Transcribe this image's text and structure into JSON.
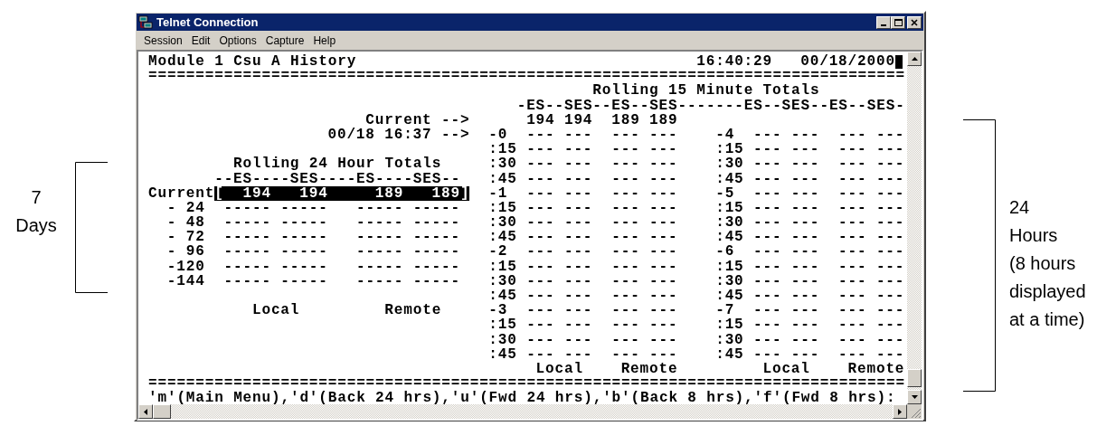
{
  "window": {
    "title": "Telnet Connection"
  },
  "menu": [
    "Session",
    "Edit",
    "Options",
    "Capture",
    "Help"
  ],
  "terminal": {
    "title": "Module 1 Csu A History",
    "time": "16:40:29",
    "date": "00/18/2000",
    "rules": [
      "================================================================================",
      "================================================================================"
    ],
    "pointers": [
      "Current -->",
      "00/18 16:37 -->"
    ],
    "minute_totals": {
      "title": "Rolling 15 Minute Totals",
      "header": "-ES--SES--ES--SES-------ES--SES--ES--SES-",
      "current_values": [
        "194",
        "194",
        "189",
        "189"
      ],
      "blocks": [
        {
          "rows": [
            {
              "label": "-0",
              "values": [
                "---",
                "---",
                "---",
                "---"
              ]
            },
            {
              "label": ":15",
              "values": [
                "---",
                "---",
                "---",
                "---"
              ]
            },
            {
              "label": ":30",
              "values": [
                "---",
                "---",
                "---",
                "---"
              ]
            },
            {
              "label": ":45",
              "values": [
                "---",
                "---",
                "---",
                "---"
              ]
            },
            {
              "label": "-1",
              "values": [
                "---",
                "---",
                "---",
                "---"
              ]
            },
            {
              "label": ":15",
              "values": [
                "---",
                "---",
                "---",
                "---"
              ]
            },
            {
              "label": ":30",
              "values": [
                "---",
                "---",
                "---",
                "---"
              ]
            },
            {
              "label": ":45",
              "values": [
                "---",
                "---",
                "---",
                "---"
              ]
            },
            {
              "label": "-2",
              "values": [
                "---",
                "---",
                "---",
                "---"
              ]
            },
            {
              "label": ":15",
              "values": [
                "---",
                "---",
                "---",
                "---"
              ]
            },
            {
              "label": ":30",
              "values": [
                "---",
                "---",
                "---",
                "---"
              ]
            },
            {
              "label": ":45",
              "values": [
                "---",
                "---",
                "---",
                "---"
              ]
            },
            {
              "label": "-3",
              "values": [
                "---",
                "---",
                "---",
                "---"
              ]
            },
            {
              "label": ":15",
              "values": [
                "---",
                "---",
                "---",
                "---"
              ]
            },
            {
              "label": ":30",
              "values": [
                "---",
                "---",
                "---",
                "---"
              ]
            },
            {
              "label": ":45",
              "values": [
                "---",
                "---",
                "---",
                "---"
              ]
            }
          ]
        },
        {
          "rows": [
            {
              "label": "-4",
              "values": [
                "---",
                "---",
                "---",
                "---"
              ]
            },
            {
              "label": ":15",
              "values": [
                "---",
                "---",
                "---",
                "---"
              ]
            },
            {
              "label": ":30",
              "values": [
                "---",
                "---",
                "---",
                "---"
              ]
            },
            {
              "label": ":45",
              "values": [
                "---",
                "---",
                "---",
                "---"
              ]
            },
            {
              "label": "-5",
              "values": [
                "---",
                "---",
                "---",
                "---"
              ]
            },
            {
              "label": ":15",
              "values": [
                "---",
                "---",
                "---",
                "---"
              ]
            },
            {
              "label": ":30",
              "values": [
                "---",
                "---",
                "---",
                "---"
              ]
            },
            {
              "label": ":45",
              "values": [
                "---",
                "---",
                "---",
                "---"
              ]
            },
            {
              "label": "-6",
              "values": [
                "---",
                "---",
                "---",
                "---"
              ]
            },
            {
              "label": ":15",
              "values": [
                "---",
                "---",
                "---",
                "---"
              ]
            },
            {
              "label": ":30",
              "values": [
                "---",
                "---",
                "---",
                "---"
              ]
            },
            {
              "label": ":45",
              "values": [
                "---",
                "---",
                "---",
                "---"
              ]
            },
            {
              "label": "-7",
              "values": [
                "---",
                "---",
                "---",
                "---"
              ]
            },
            {
              "label": ":15",
              "values": [
                "---",
                "---",
                "---",
                "---"
              ]
            },
            {
              "label": ":30",
              "values": [
                "---",
                "---",
                "---",
                "---"
              ]
            },
            {
              "label": ":45",
              "values": [
                "---",
                "---",
                "---",
                "---"
              ]
            }
          ]
        }
      ],
      "footer": [
        "Local",
        "Remote",
        "Local",
        "Remote"
      ]
    },
    "day_totals": {
      "title": "Rolling 24 Hour Totals",
      "header": "--ES----SES----ES----SES--",
      "rows": [
        {
          "label": "Current",
          "open": "[",
          "close": "]",
          "selected": true,
          "values": [
            "194",
            "194",
            "189",
            "189"
          ]
        },
        {
          "label": "- 24",
          "selected": false,
          "values": [
            "-----",
            "-----",
            "-----",
            "-----"
          ]
        },
        {
          "label": "- 48",
          "selected": false,
          "values": [
            "-----",
            "-----",
            "-----",
            "-----"
          ]
        },
        {
          "label": "- 72",
          "selected": false,
          "values": [
            "-----",
            "-----",
            "-----",
            "-----"
          ]
        },
        {
          "label": "- 96",
          "selected": false,
          "values": [
            "-----",
            "-----",
            "-----",
            "-----"
          ]
        },
        {
          "label": "-120",
          "selected": false,
          "values": [
            "-----",
            "-----",
            "-----",
            "-----"
          ]
        },
        {
          "label": "-144",
          "selected": false,
          "values": [
            "-----",
            "-----",
            "-----",
            "-----"
          ]
        }
      ],
      "footer": [
        "Local",
        "Remote"
      ]
    },
    "prompt": "'m'(Main Menu),'d'(Back 24 hrs),'u'(Fwd 24 hrs),'b'(Back 8 hrs),'f'(Fwd 8 hrs):"
  },
  "annotations": [
    {
      "lines": [
        "7",
        "Days"
      ]
    },
    {
      "lines": [
        "24",
        "Hours",
        "(8 hours",
        "displayed",
        "at a time)"
      ]
    }
  ]
}
